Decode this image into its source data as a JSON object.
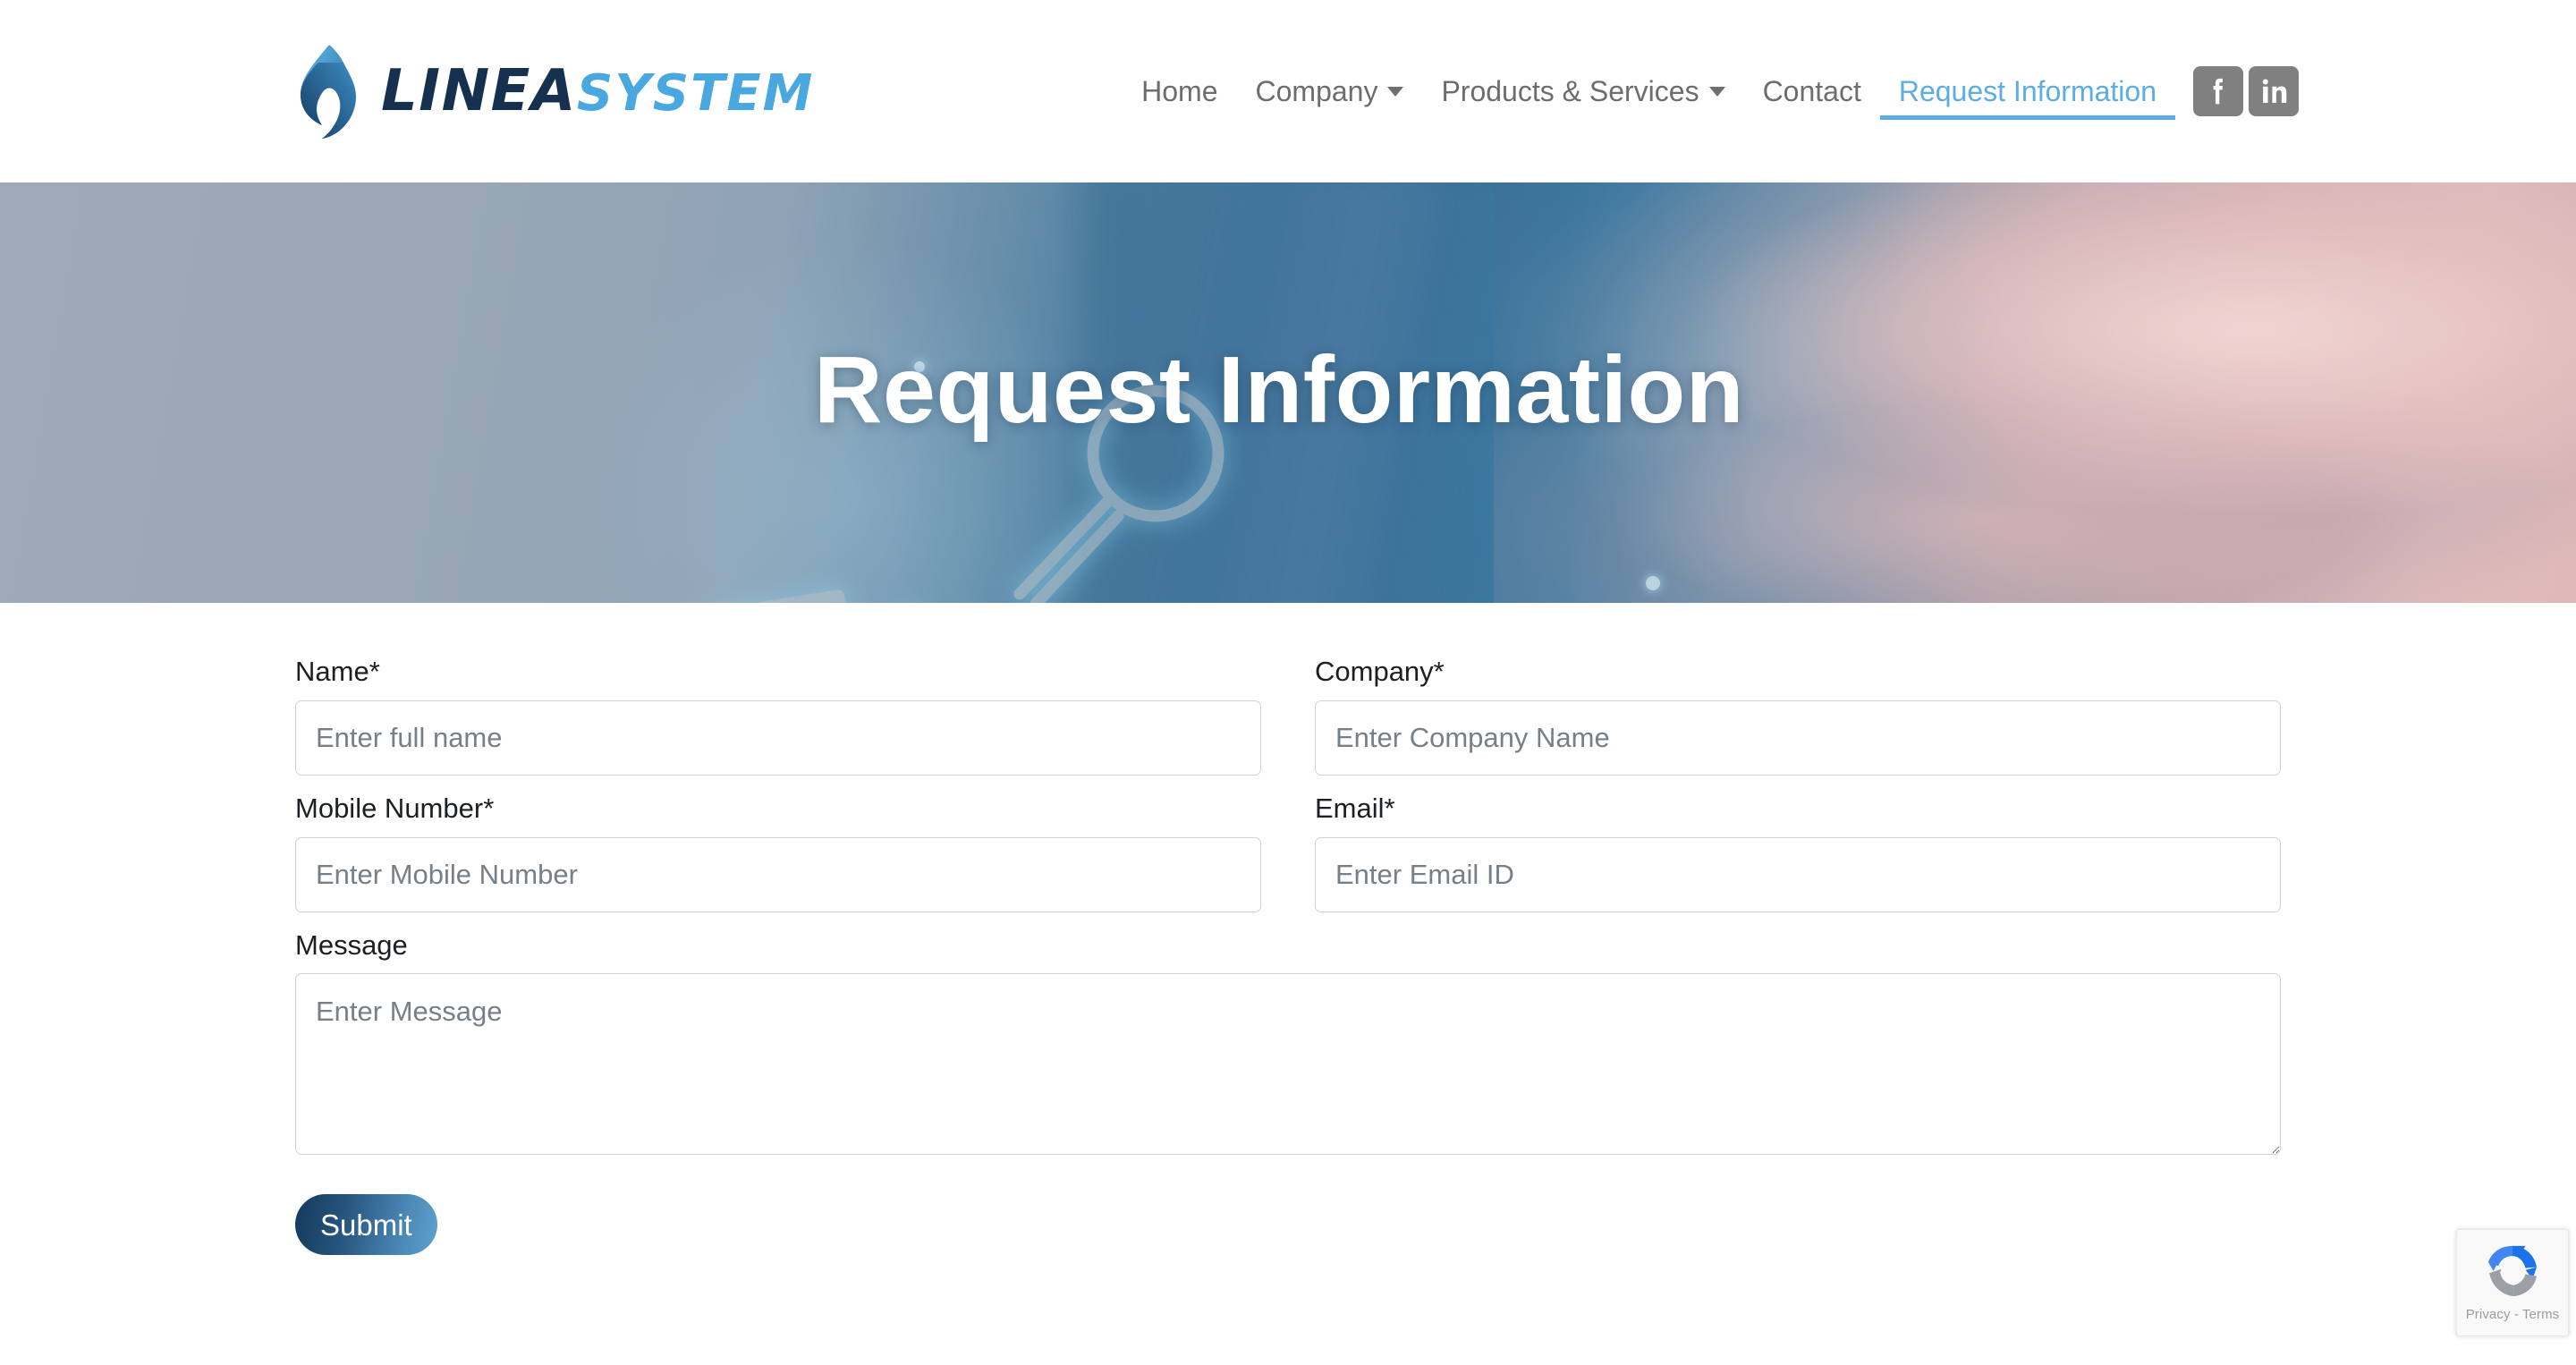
{
  "header": {
    "logo": {
      "icon": "flame-logo-icon",
      "text_primary": "LINEA",
      "text_secondary": "SYSTEM"
    },
    "nav": [
      {
        "label": "Home",
        "has_dropdown": false,
        "active": false
      },
      {
        "label": "Company",
        "has_dropdown": true,
        "active": false
      },
      {
        "label": "Products & Services",
        "has_dropdown": true,
        "active": false
      },
      {
        "label": "Contact",
        "has_dropdown": false,
        "active": false
      },
      {
        "label": "Request Information",
        "has_dropdown": false,
        "active": true
      }
    ],
    "social": [
      {
        "name": "facebook-icon",
        "label": "Facebook"
      },
      {
        "name": "linkedin-icon",
        "label": "LinkedIn"
      }
    ],
    "accent_color": "#5dade2",
    "nav_color": "#6d6d6d",
    "social_tile_color": "#808080"
  },
  "hero": {
    "title": "Request Information"
  },
  "form": {
    "fields": {
      "name": {
        "label": "Name*",
        "placeholder": "Enter full name",
        "value": ""
      },
      "company": {
        "label": "Company*",
        "placeholder": "Enter Company Name",
        "value": ""
      },
      "mobile": {
        "label": "Mobile Number*",
        "placeholder": "Enter Mobile Number",
        "value": ""
      },
      "email": {
        "label": "Email*",
        "placeholder": "Enter Email ID",
        "value": ""
      },
      "message": {
        "label": "Message",
        "placeholder": "Enter Message",
        "value": ""
      }
    },
    "submit_label": "Submit"
  },
  "recaptcha": {
    "icon": "recaptcha-icon",
    "links": "Privacy - Terms"
  }
}
